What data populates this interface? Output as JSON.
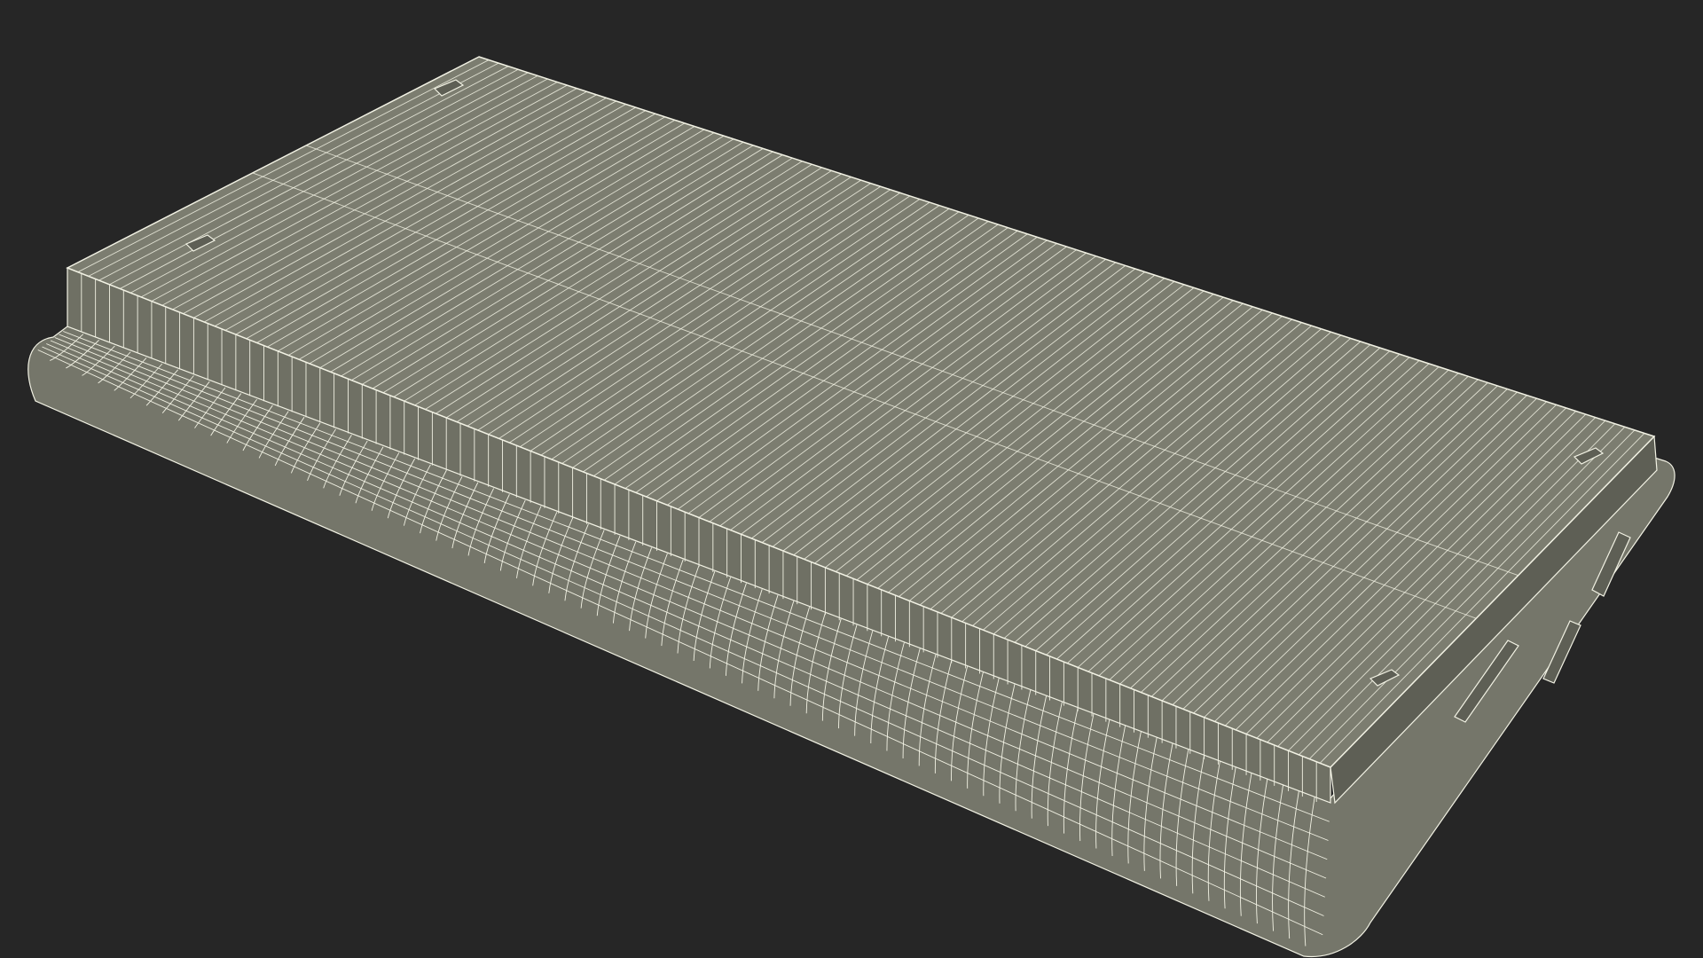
{
  "scene": {
    "subject": "laptop-wireframe-render",
    "colors": {
      "background": "#262626",
      "surface_top": "#7c7d70",
      "surface_side": "#6f7064",
      "surface_base": "#75766a",
      "surface_dark": "#5e5f55",
      "wire": "#f2f2e4"
    }
  }
}
